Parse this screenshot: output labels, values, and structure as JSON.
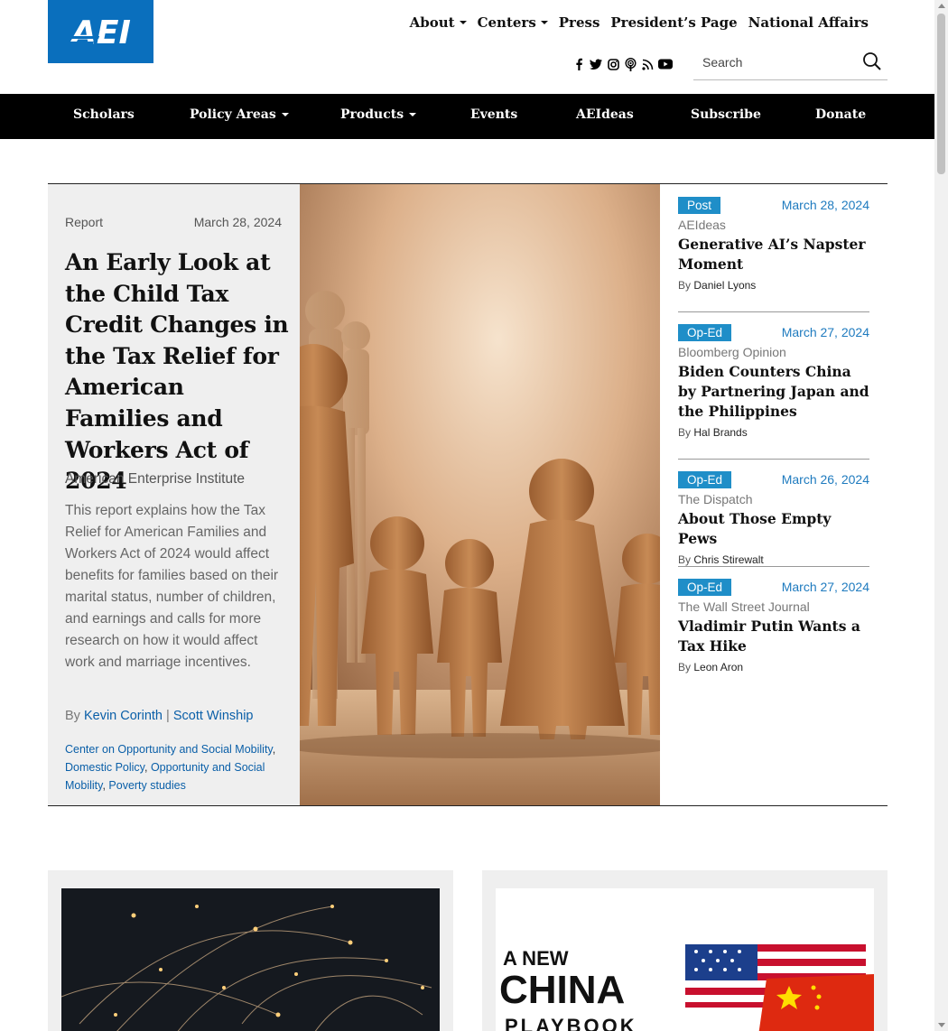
{
  "header": {
    "logo_text": "AEI",
    "top_nav": [
      {
        "label": "About",
        "dropdown": true
      },
      {
        "label": "Centers",
        "dropdown": true
      },
      {
        "label": "Press",
        "dropdown": false
      },
      {
        "label": "President’s Page",
        "dropdown": false
      },
      {
        "label": "National Affairs",
        "dropdown": false
      }
    ],
    "social_icons": [
      "facebook-icon",
      "twitter-icon",
      "instagram-icon",
      "podcast-icon",
      "rss-icon",
      "youtube-icon"
    ],
    "search": {
      "placeholder": "Search",
      "value": ""
    }
  },
  "main_nav": [
    {
      "label": "Scholars",
      "dropdown": false
    },
    {
      "label": "Policy Areas",
      "dropdown": true
    },
    {
      "label": "Products",
      "dropdown": true
    },
    {
      "label": "Events",
      "dropdown": false
    },
    {
      "label": "AEIdeas",
      "dropdown": false
    },
    {
      "label": "Subscribe",
      "dropdown": false
    },
    {
      "label": "Donate",
      "dropdown": false
    }
  ],
  "feature": {
    "type": "Report",
    "date": "March 28, 2024",
    "title": "An Early Look at the Child Tax Credit Changes in the Tax Relief for American Families and Workers Act of 2024",
    "organization": "American Enterprise Institute",
    "description": "This report explains how the Tax Relief for American Families and Workers Act of 2024 would affect benefits for families based on their marital status, number of children, and earnings and calls for more research on how it would affect work and marriage incentives.",
    "by": "By",
    "authors": [
      "Kevin Corinth",
      "Scott Winship"
    ],
    "author_separator": "|",
    "tags": [
      "Center on Opportunity and Social Mobility",
      "Domestic Policy",
      "Opportunity and Social Mobility",
      "Poverty studies"
    ]
  },
  "sidebar": [
    {
      "type": "Post",
      "date": "March 28, 2024",
      "source": "AEIdeas",
      "title": "Generative AI’s Napster Moment",
      "by": "By",
      "author": "Daniel Lyons"
    },
    {
      "type": "Op-Ed",
      "date": "March 27, 2024",
      "source": "Bloomberg Opinion",
      "title": "Biden Counters China by Partnering Japan and the Philippines",
      "by": "By",
      "author": "Hal Brands"
    },
    {
      "type": "Op-Ed",
      "date": "March 26, 2024",
      "source": "The Dispatch",
      "title": "About Those Empty Pews",
      "by": "By",
      "author": "Chris Stirewalt"
    },
    {
      "type": "Op-Ed",
      "date": "March 27, 2024",
      "source": "The Wall Street Journal",
      "title": "Vladimir Putin Wants a Tax Hike",
      "by": "By",
      "author": "Leon Aron"
    }
  ],
  "cards": {
    "right_image_text": {
      "line1": "A NEW",
      "line2": "CHINA",
      "line3": "PLAYBOOK"
    }
  },
  "colors": {
    "brand_blue": "#0a6fbd",
    "badge_blue": "#1f8ec8",
    "nav_bg": "#000000"
  }
}
